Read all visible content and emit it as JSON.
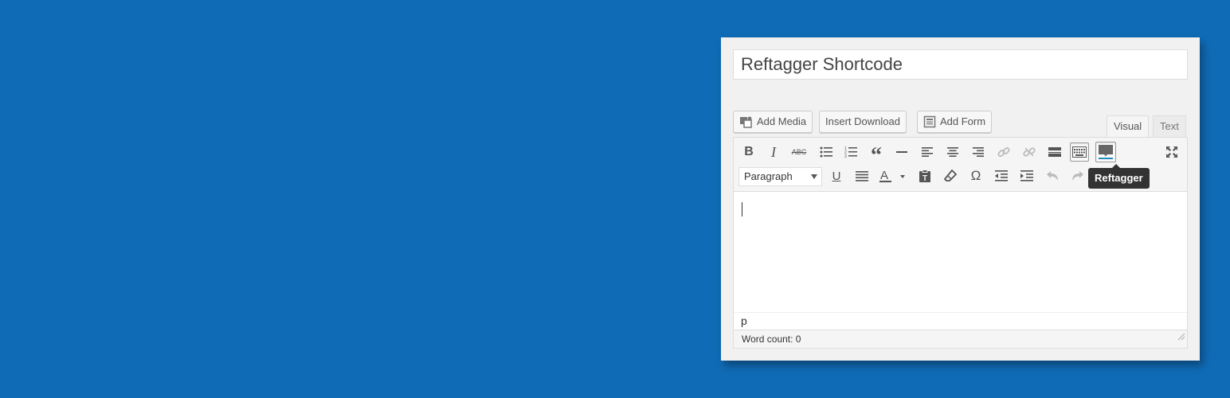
{
  "colors": {
    "background": "#106bb6",
    "panel": "#f1f1f1",
    "tooltip": "#333333"
  },
  "title": {
    "value": "Reftagger Shortcode"
  },
  "media_buttons": [
    {
      "label": "Add Media",
      "icon": "media-icon"
    },
    {
      "label": "Insert Download",
      "icon": ""
    },
    {
      "label": "Add Form",
      "icon": "form-icon"
    }
  ],
  "tabs": {
    "visual": "Visual",
    "text": "Text",
    "active": "visual"
  },
  "toolbar": {
    "row1": [
      "bold-icon",
      "italic-icon",
      "strikethrough-icon",
      "bullet-list-icon",
      "numbered-list-icon",
      "blockquote-icon",
      "horizontal-rule-icon",
      "align-left-icon",
      "align-center-icon",
      "align-right-icon",
      "link-icon",
      "unlink-icon",
      "read-more-icon",
      "toolbar-toggle-icon",
      "reftagger-icon",
      "fullscreen-icon"
    ],
    "row2": [
      "underline-icon",
      "justify-icon",
      "text-color-icon",
      "paste-text-icon",
      "clear-formatting-icon",
      "special-character-icon",
      "outdent-icon",
      "indent-icon",
      "undo-icon",
      "redo-icon"
    ],
    "format_select": "Paragraph",
    "tooltip": "Reftagger"
  },
  "editor": {
    "path": "p",
    "word_count": "Word count: 0"
  }
}
